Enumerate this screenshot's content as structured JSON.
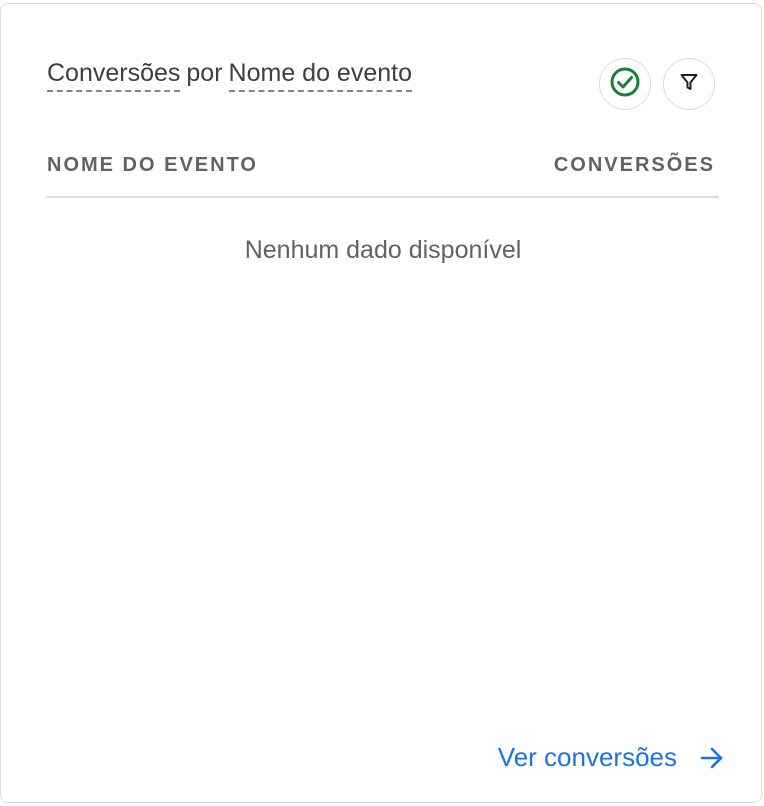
{
  "card": {
    "title_metric": "Conversões",
    "title_sep": "por",
    "title_dimension": "Nome do evento",
    "status_icon": "check-circle-icon",
    "filter_icon": "filter-icon",
    "status_color": "#188038",
    "filter_color": "#202124"
  },
  "table": {
    "columns": [
      "NOME DO EVENTO",
      "CONVERSÕES"
    ],
    "empty_message": "Nenhum dado disponível"
  },
  "footer": {
    "link_label": "Ver conversões",
    "link_icon": "arrow-right-icon",
    "link_color": "#1a73e8"
  }
}
